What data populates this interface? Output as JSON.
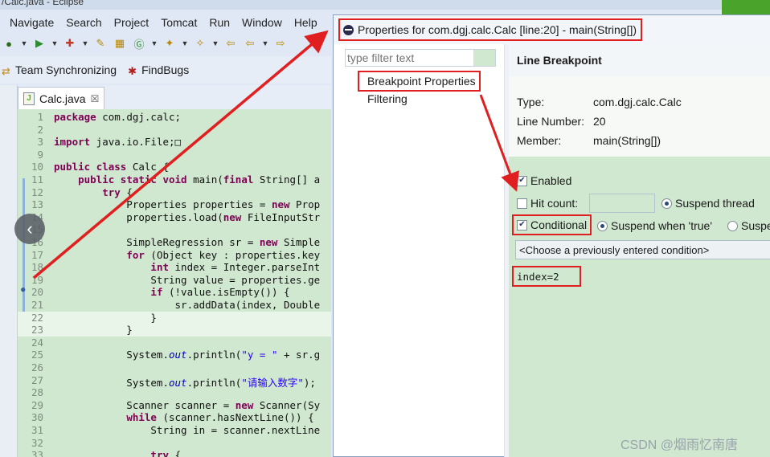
{
  "window": {
    "title_fragment": "/Calc.java - Eclipse"
  },
  "menu": [
    "Navigate",
    "Search",
    "Project",
    "Tomcat",
    "Run",
    "Window",
    "Help"
  ],
  "perspectives": [
    {
      "label": "Team Synchronizing",
      "icon": "team-sync-icon"
    },
    {
      "label": "FindBugs",
      "icon": "bug-icon"
    }
  ],
  "editor": {
    "tab_label": "Calc.java",
    "tab_close": "☒",
    "lines": [
      {
        "n": "1",
        "t": "package com.dgj.calc;"
      },
      {
        "n": "2",
        "t": ""
      },
      {
        "n": "3",
        "t": "import java.io.File;□"
      },
      {
        "n": "9",
        "t": ""
      },
      {
        "n": "10",
        "t": "public class Calc {"
      },
      {
        "n": "11",
        "t": "    public static void main(final String[] a"
      },
      {
        "n": "12",
        "t": "        try {"
      },
      {
        "n": "13",
        "t": "            Properties properties = new Prop"
      },
      {
        "n": "14",
        "t": "            properties.load(new FileInputStr"
      },
      {
        "n": "15",
        "t": ""
      },
      {
        "n": "16",
        "t": "            SimpleRegression sr = new Simple"
      },
      {
        "n": "17",
        "t": "            for (Object key : properties.key"
      },
      {
        "n": "18",
        "t": "                int index = Integer.parseInt"
      },
      {
        "n": "19",
        "t": "                String value = properties.ge"
      },
      {
        "n": "20",
        "t": "                if (!value.isEmpty()) {"
      },
      {
        "n": "21",
        "t": "                    sr.addData(index, Double"
      },
      {
        "n": "22",
        "t": "                }"
      },
      {
        "n": "23",
        "t": "            }"
      },
      {
        "n": "24",
        "t": ""
      },
      {
        "n": "25",
        "t": "            System.out.println(\"y = \" + sr.g"
      },
      {
        "n": "26",
        "t": ""
      },
      {
        "n": "27",
        "t": "            System.out.println(\"请输入数字\");"
      },
      {
        "n": "28",
        "t": ""
      },
      {
        "n": "29",
        "t": "            Scanner scanner = new Scanner(Sy"
      },
      {
        "n": "30",
        "t": "            while (scanner.hasNextLine()) {"
      },
      {
        "n": "31",
        "t": "                String in = scanner.nextLine"
      },
      {
        "n": "32",
        "t": ""
      },
      {
        "n": "33",
        "t": "                try {"
      }
    ]
  },
  "dialog": {
    "title": "Properties for com.dgj.calc.Calc [line:20] - main(String[])",
    "filter_placeholder": "type filter text",
    "tree": {
      "breakpoint_properties": "Breakpoint Properties",
      "filtering": "Filtering"
    },
    "page_title": "Line Breakpoint",
    "info": {
      "type_label": "Type:",
      "type_value": "com.dgj.calc.Calc",
      "line_label": "Line Number:",
      "line_value": "20",
      "member_label": "Member:",
      "member_value": "main(String[])"
    },
    "enabled_label": "Enabled",
    "hit_count_label": "Hit count:",
    "suspend_thread_label": "Suspend thread",
    "conditional_label": "Conditional",
    "suspend_true_label": "Suspend when 'true'",
    "suspend_changes_label": "Suspe",
    "condition_select": "<Choose a previously entered condition>",
    "condition_text": "index=2"
  },
  "watermark": "CSDN @烟雨忆南唐",
  "colors": {
    "highlight_red": "#e02020",
    "editor_bg": "#cfe8cf"
  }
}
